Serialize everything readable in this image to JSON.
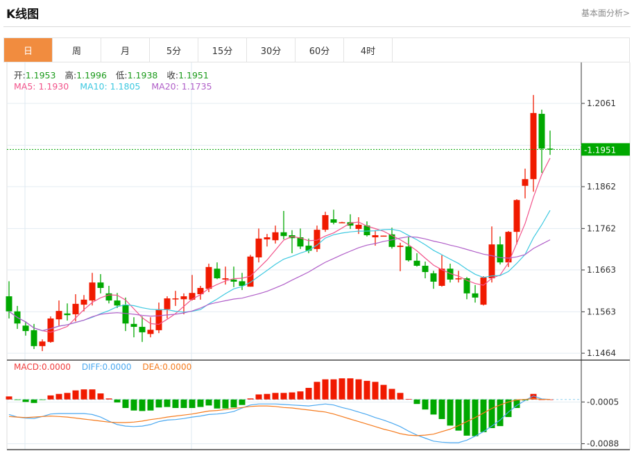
{
  "header": {
    "title": "K线图",
    "link": "基本面分析>"
  },
  "tabs": [
    {
      "label": "日",
      "active": true
    },
    {
      "label": "周",
      "active": false
    },
    {
      "label": "月",
      "active": false
    },
    {
      "label": "5分",
      "active": false
    },
    {
      "label": "15分",
      "active": false
    },
    {
      "label": "30分",
      "active": false
    },
    {
      "label": "60分",
      "active": false
    },
    {
      "label": "4时",
      "active": false
    }
  ],
  "ohlc_legend": {
    "open_label": "开:",
    "open": "1.1953",
    "high_label": "高:",
    "high": "1.1996",
    "low_label": "低:",
    "low": "1.1938",
    "close_label": "收:",
    "close": "1.1951"
  },
  "ma_legend": {
    "ma5": "MA5: 1.1930",
    "ma10": "MA10: 1.1805",
    "ma20": "MA20: 1.1735"
  },
  "macd_legend": {
    "macd": "MACD:0.0000",
    "diff": "DIFF:0.0000",
    "dea": "DEA:0.0000"
  },
  "colors": {
    "up": "#f01a00",
    "down": "#00a800",
    "ma5": "#f2528a",
    "ma10": "#3cc8e0",
    "ma20": "#b05ec8",
    "diff": "#4aa8f0",
    "dea": "#f57a1c",
    "active_tab": "#f18c3f",
    "price_tag": "#00a800"
  },
  "chart_data": [
    {
      "type": "candlestick",
      "y_ticks": [
        "1.2061",
        "1.1862",
        "1.1762",
        "1.1663",
        "1.1563",
        "1.1464"
      ],
      "ylim": [
        1.1464,
        1.2061
      ],
      "current_price": "1.1951",
      "ohlc": [
        [
          1.16,
          1.1636,
          1.1547,
          1.1564
        ],
        [
          1.1564,
          1.1577,
          1.1522,
          1.1535
        ],
        [
          1.153,
          1.154,
          1.1506,
          1.1517
        ],
        [
          1.1519,
          1.1534,
          1.1474,
          1.1481
        ],
        [
          1.1481,
          1.1497,
          1.1469,
          1.1492
        ],
        [
          1.1491,
          1.1552,
          1.1489,
          1.1547
        ],
        [
          1.1545,
          1.159,
          1.153,
          1.1565
        ],
        [
          1.1559,
          1.1583,
          1.1542,
          1.1555
        ],
        [
          1.1557,
          1.1605,
          1.154,
          1.1582
        ],
        [
          1.158,
          1.1603,
          1.1564,
          1.1592
        ],
        [
          1.159,
          1.1656,
          1.1578,
          1.1633
        ],
        [
          1.1633,
          1.1653,
          1.1607,
          1.162
        ],
        [
          1.1607,
          1.1625,
          1.1583,
          1.159
        ],
        [
          1.159,
          1.1608,
          1.1572,
          1.1578
        ],
        [
          1.158,
          1.1597,
          1.1517,
          1.1535
        ],
        [
          1.1534,
          1.155,
          1.1502,
          1.1527
        ],
        [
          1.1527,
          1.1552,
          1.1491,
          1.1514
        ],
        [
          1.151,
          1.155,
          1.1502,
          1.152
        ],
        [
          1.1519,
          1.1585,
          1.1512,
          1.1569
        ],
        [
          1.1569,
          1.16,
          1.1547,
          1.1595
        ],
        [
          1.1593,
          1.1613,
          1.1577,
          1.1595
        ],
        [
          1.1593,
          1.1607,
          1.1557,
          1.16
        ],
        [
          1.1592,
          1.1651,
          1.159,
          1.1608
        ],
        [
          1.1605,
          1.1625,
          1.1592,
          1.162
        ],
        [
          1.1618,
          1.1678,
          1.161,
          1.167
        ],
        [
          1.1666,
          1.1681,
          1.1641,
          1.1643
        ],
        [
          1.164,
          1.1671,
          1.1628,
          1.1643
        ],
        [
          1.164,
          1.1671,
          1.1622,
          1.1635
        ],
        [
          1.1636,
          1.1656,
          1.1615,
          1.1625
        ],
        [
          1.1623,
          1.1699,
          1.1623,
          1.1695
        ],
        [
          1.1693,
          1.1762,
          1.1681,
          1.1738
        ],
        [
          1.1736,
          1.1749,
          1.1719,
          1.1741
        ],
        [
          1.1734,
          1.1769,
          1.1726,
          1.1753
        ],
        [
          1.1753,
          1.1804,
          1.1736,
          1.1744
        ],
        [
          1.1746,
          1.1758,
          1.1703,
          1.1739
        ],
        [
          1.1741,
          1.1762,
          1.1713,
          1.1719
        ],
        [
          1.1721,
          1.1738,
          1.1703,
          1.1709
        ],
        [
          1.1713,
          1.1769,
          1.1706,
          1.1759
        ],
        [
          1.1759,
          1.1802,
          1.1754,
          1.1794
        ],
        [
          1.1784,
          1.1807,
          1.1772,
          1.1776
        ],
        [
          1.1776,
          1.1778,
          1.1776,
          1.1777
        ],
        [
          1.1777,
          1.1796,
          1.1761,
          1.1769
        ],
        [
          1.1761,
          1.1789,
          1.1749,
          1.1771
        ],
        [
          1.1769,
          1.1779,
          1.1743,
          1.1746
        ],
        [
          1.1741,
          1.1758,
          1.1721,
          1.1746
        ],
        [
          1.1744,
          1.1745,
          1.1744,
          1.1745
        ],
        [
          1.1748,
          1.1764,
          1.1714,
          1.1718
        ],
        [
          1.1718,
          1.1728,
          1.166,
          1.1721
        ],
        [
          1.1719,
          1.1743,
          1.1683,
          1.1686
        ],
        [
          1.1685,
          1.1703,
          1.1671,
          1.1673
        ],
        [
          1.1673,
          1.1683,
          1.1643,
          1.1658
        ],
        [
          1.1655,
          1.1661,
          1.1618,
          1.1635
        ],
        [
          1.1625,
          1.1698,
          1.1623,
          1.1666
        ],
        [
          1.1666,
          1.1678,
          1.1633,
          1.164
        ],
        [
          1.1641,
          1.1661,
          1.1633,
          1.1643
        ],
        [
          1.1643,
          1.1646,
          1.1593,
          1.1607
        ],
        [
          1.1607,
          1.1627,
          1.1585,
          1.1597
        ],
        [
          1.158,
          1.1648,
          1.1578,
          1.1645
        ],
        [
          1.1643,
          1.1767,
          1.1633,
          1.1724
        ],
        [
          1.1724,
          1.1743,
          1.1676,
          1.1681
        ],
        [
          1.1681,
          1.1756,
          1.167,
          1.1754
        ],
        [
          1.1754,
          1.1832,
          1.1724,
          1.183
        ],
        [
          1.1864,
          1.1905,
          1.1834,
          1.188
        ],
        [
          1.188,
          1.2081,
          1.185,
          1.2038
        ],
        [
          1.2036,
          1.2046,
          1.1895,
          1.1953
        ],
        [
          1.1953,
          1.1996,
          1.1938,
          1.1951
        ]
      ],
      "ma_periods": [
        5,
        10,
        20
      ]
    },
    {
      "type": "macd",
      "y_ticks": [
        "-0.0005",
        "-0.0088"
      ],
      "histogram": [
        0.0006,
        -0.0001,
        -0.0005,
        -0.0007,
        -0.0001,
        0.0008,
        0.0011,
        0.0013,
        0.0018,
        0.002,
        0.002,
        0.0012,
        0.0002,
        -0.0006,
        -0.0017,
        -0.0022,
        -0.0023,
        -0.0022,
        -0.0016,
        -0.0015,
        -0.0017,
        -0.0017,
        -0.0017,
        -0.0015,
        -0.0012,
        -0.0018,
        -0.0018,
        -0.0016,
        -0.0011,
        0.0002,
        0.001,
        0.0011,
        0.0013,
        0.0013,
        0.0014,
        0.0016,
        0.0023,
        0.0035,
        0.004,
        0.004,
        0.0042,
        0.0042,
        0.004,
        0.0037,
        0.0035,
        0.0029,
        0.0021,
        0.0013,
        0.0001,
        -0.0009,
        -0.002,
        -0.003,
        -0.0039,
        -0.0052,
        -0.0062,
        -0.0072,
        -0.0073,
        -0.0065,
        -0.0057,
        -0.0053,
        -0.0035,
        -0.0017,
        -0.0002,
        0.0011,
        0.0,
        0.0
      ],
      "diff": [
        -0.003,
        -0.0035,
        -0.0037,
        -0.0038,
        -0.0034,
        -0.0029,
        -0.0028,
        -0.0028,
        -0.0028,
        -0.0028,
        -0.003,
        -0.0035,
        -0.0043,
        -0.005,
        -0.0053,
        -0.0054,
        -0.0053,
        -0.005,
        -0.0044,
        -0.0041,
        -0.004,
        -0.0038,
        -0.0035,
        -0.0033,
        -0.003,
        -0.0029,
        -0.0027,
        -0.0024,
        -0.0017,
        -0.0011,
        -0.0009,
        -0.0009,
        -0.0009,
        -0.001,
        -0.0011,
        -0.0012,
        -0.0013,
        -0.0011,
        -0.0009,
        -0.0011,
        -0.0016,
        -0.002,
        -0.0025,
        -0.003,
        -0.0036,
        -0.0041,
        -0.0047,
        -0.0054,
        -0.0063,
        -0.0071,
        -0.0077,
        -0.0083,
        -0.0085,
        -0.0086,
        -0.0086,
        -0.0081,
        -0.0073,
        -0.0064,
        -0.0053,
        -0.0041,
        -0.0025,
        -0.0012,
        -0.0002,
        0.0007,
        0.0001,
        0.0
      ],
      "dea": [
        -0.0034,
        -0.0035,
        -0.0036,
        -0.0035,
        -0.0034,
        -0.0033,
        -0.0034,
        -0.0035,
        -0.0037,
        -0.0039,
        -0.0041,
        -0.0043,
        -0.0045,
        -0.0046,
        -0.0046,
        -0.0045,
        -0.0043,
        -0.004,
        -0.0038,
        -0.0035,
        -0.0033,
        -0.0031,
        -0.0029,
        -0.0026,
        -0.0023,
        -0.0022,
        -0.002,
        -0.0018,
        -0.0016,
        -0.0014,
        -0.0013,
        -0.0013,
        -0.0014,
        -0.0016,
        -0.0017,
        -0.0019,
        -0.0021,
        -0.0023,
        -0.0025,
        -0.0029,
        -0.0034,
        -0.0039,
        -0.0044,
        -0.0049,
        -0.0054,
        -0.0059,
        -0.0063,
        -0.0068,
        -0.0071,
        -0.0072,
        -0.0071,
        -0.0069,
        -0.0064,
        -0.0059,
        -0.0052,
        -0.0044,
        -0.0036,
        -0.0027,
        -0.0018,
        -0.0011,
        -0.0005,
        -0.0001,
        0.0,
        0.0002,
        0.0,
        0.0
      ]
    }
  ]
}
